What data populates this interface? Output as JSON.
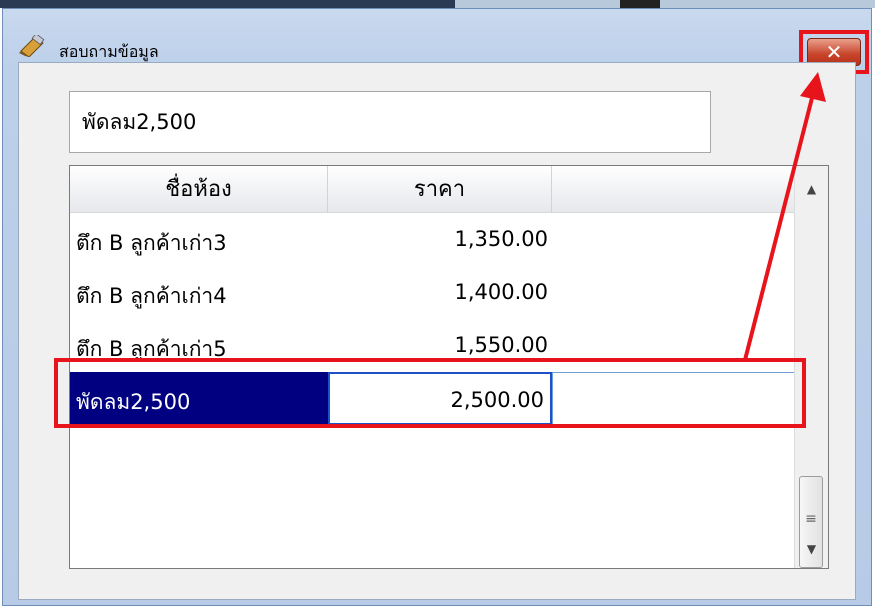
{
  "window": {
    "title": "สอบถามข้อมูล",
    "close_label": "✕"
  },
  "search": {
    "value": "พัดลม2,500"
  },
  "grid": {
    "columns": [
      "ชื่อห้อง",
      "ราคา"
    ],
    "rows": [
      {
        "name": "ตึก B ลูกค้าเก่า3",
        "price": "1,350.00"
      },
      {
        "name": "ตึก B ลูกค้าเก่า4",
        "price": "1,400.00"
      },
      {
        "name": "ตึก B ลูกค้าเก่า5",
        "price": "1,550.00"
      }
    ],
    "selected_row": {
      "name": "พัดลม2,500",
      "price": "2,500.00"
    }
  },
  "icons": {
    "app": "pencil-eraser-icon",
    "close": "close-icon",
    "scroll_up": "scroll-up-arrow-icon",
    "scroll_down": "scroll-down-arrow-icon",
    "scroll_grip": "grip-icon"
  },
  "colors": {
    "selection": "#000080",
    "annotation": "#e8141b",
    "edit_border": "#1e50c8"
  }
}
